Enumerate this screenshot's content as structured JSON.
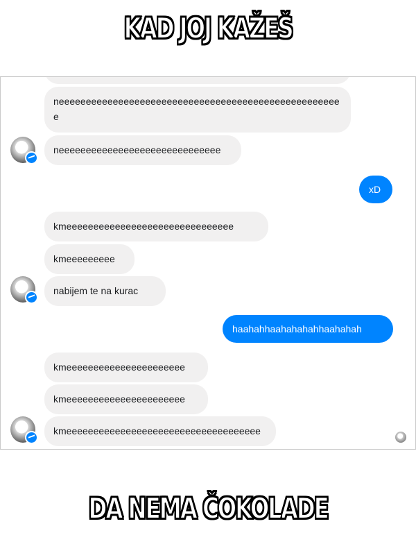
{
  "meme": {
    "top_text": "KAD JOJ KAŽEŠ",
    "bottom_text": "DA NEMA ČOKOLADE"
  },
  "chat": {
    "messages": [
      {
        "sender": "other",
        "text": "neeeeeeeeeeeeeeeeeeeeeeeeeeeeeeeeeeeeeeeeeeeeeeeeeeeee"
      },
      {
        "sender": "other",
        "text": "neeeeeeeeeeeeeeeeeeeeeeeeeeeeee"
      },
      {
        "sender": "me",
        "text": "xD"
      },
      {
        "sender": "other",
        "text": "kmeeeeeeeeeeeeeeeeeeeeeeeeeeeeeee"
      },
      {
        "sender": "other",
        "text": "kmeeeeeeeee"
      },
      {
        "sender": "other",
        "text": "nabijem te na kurac"
      },
      {
        "sender": "me",
        "text": "haahahhaahahahahhaahahah"
      },
      {
        "sender": "other",
        "text": "kmeeeeeeeeeeeeeeeeeeeeee"
      },
      {
        "sender": "other",
        "text": "kmeeeeeeeeeeeeeeeeeeeeee"
      },
      {
        "sender": "other",
        "text": "kmeeeeeeeeeeeeeeeeeeeeeeeeeeeeeeeeeeee"
      }
    ]
  },
  "colors": {
    "outgoing_bubble": "#0084ff",
    "incoming_bubble": "#f1f0f0",
    "messenger_badge": "#0084ff"
  }
}
